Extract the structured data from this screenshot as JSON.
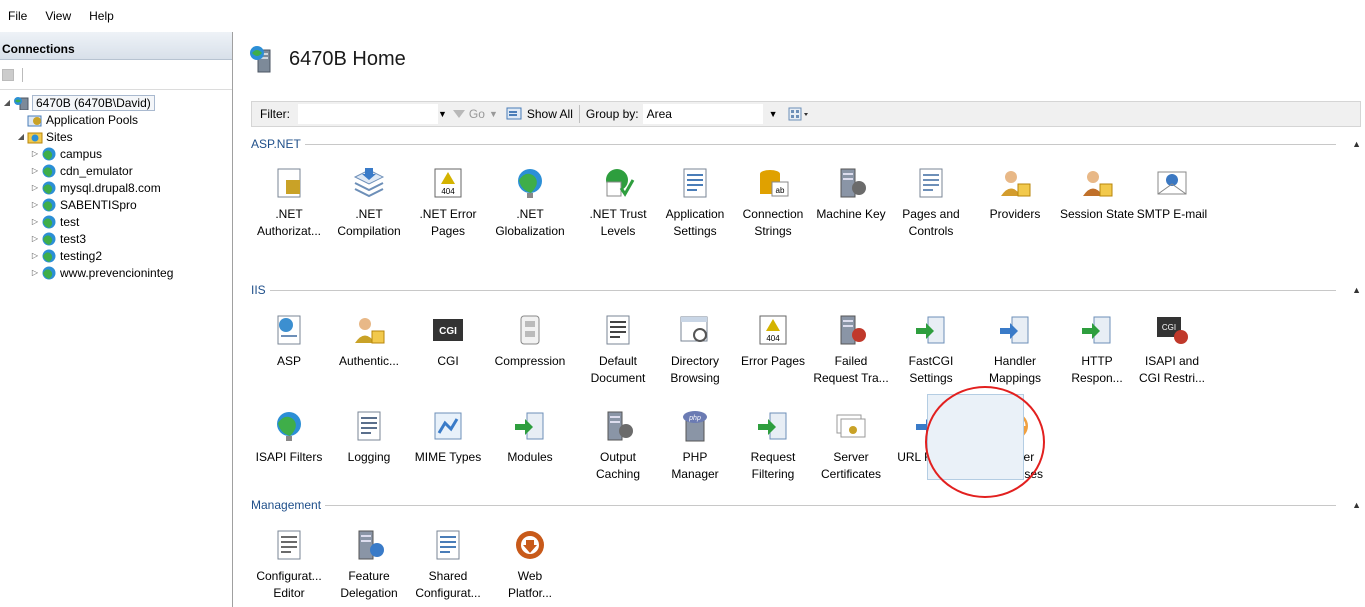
{
  "menu": [
    "File",
    "View",
    "Help"
  ],
  "connections": {
    "header": "Connections",
    "tree": [
      {
        "label": "6470B (6470B\\David)",
        "level": 0,
        "icon": "server-icon"
      },
      {
        "label": "Application Pools",
        "level": 1,
        "icon": "app-pools-icon"
      },
      {
        "label": "Sites",
        "level": 1,
        "icon": "sites-folder-icon"
      },
      {
        "label": "campus",
        "level": 2,
        "icon": "globe-icon"
      },
      {
        "label": "cdn_emulator",
        "level": 2,
        "icon": "globe-icon"
      },
      {
        "label": "mysql.drupal8.com",
        "level": 2,
        "icon": "globe-icon"
      },
      {
        "label": "SABENTISpro",
        "level": 2,
        "icon": "globe-icon"
      },
      {
        "label": "test",
        "level": 2,
        "icon": "globe-icon"
      },
      {
        "label": "test3",
        "level": 2,
        "icon": "globe-icon"
      },
      {
        "label": "testing2",
        "level": 2,
        "icon": "globe-icon"
      },
      {
        "label": "www.prevencioninteg",
        "level": 2,
        "icon": "globe-icon"
      }
    ]
  },
  "home": {
    "title": "6470B Home"
  },
  "filter": {
    "label": "Filter:",
    "go": "Go",
    "show_all": "Show All",
    "group_by_label": "Group by:",
    "group_by_value": "Area"
  },
  "sections": [
    {
      "label": "ASP.NET",
      "features": [
        {
          "label": ".NET\nAuthorizat...",
          "icon": "net-authorization-icon",
          "color": "#c9a227"
        },
        {
          "label": ".NET\nCompilation",
          "icon": "net-compilation-icon",
          "color": "#3a7bc8"
        },
        {
          "label": ".NET Error\nPages",
          "icon": "net-error-pages-icon",
          "color": "#d4b300"
        },
        {
          "label": ".NET\nGlobalization",
          "icon": "net-globalization-icon",
          "color": "#2c8fd6"
        },
        {
          "label": ".NET Trust\nLevels",
          "icon": "net-trust-levels-icon",
          "color": "#2e9e3e"
        },
        {
          "label": "Application\nSettings",
          "icon": "application-settings-icon",
          "color": "#4a7db8"
        },
        {
          "label": "Connection\nStrings",
          "icon": "connection-strings-icon",
          "color": "#e0a100"
        },
        {
          "label": "Machine Key",
          "icon": "machine-key-icon",
          "color": "#6b6b6b"
        },
        {
          "label": "Pages and\nControls",
          "icon": "pages-controls-icon",
          "color": "#6d8fb8"
        },
        {
          "label": "Providers",
          "icon": "providers-icon",
          "color": "#d39c2d"
        },
        {
          "label": "Session State",
          "icon": "session-state-icon",
          "color": "#c0702a"
        },
        {
          "label": "SMTP E-mail",
          "icon": "smtp-email-icon",
          "color": "#3b78c2"
        }
      ]
    },
    {
      "label": "IIS",
      "features": [
        {
          "label": "ASP",
          "icon": "asp-icon",
          "color": "#3c8fd0"
        },
        {
          "label": "Authentic...",
          "icon": "authentication-icon",
          "color": "#c9a227"
        },
        {
          "label": "CGI",
          "icon": "cgi-icon",
          "color": "#333333"
        },
        {
          "label": "Compression",
          "icon": "compression-icon",
          "color": "#8a8a8a"
        },
        {
          "label": "Default\nDocument",
          "icon": "default-document-icon",
          "color": "#444444"
        },
        {
          "label": "Directory\nBrowsing",
          "icon": "directory-browsing-icon",
          "color": "#6d8fb8"
        },
        {
          "label": "Error Pages",
          "icon": "error-pages-icon",
          "color": "#d4b300"
        },
        {
          "label": "Failed\nRequest Tra...",
          "icon": "failed-request-tracing-icon",
          "color": "#c0392b"
        },
        {
          "label": "FastCGI\nSettings",
          "icon": "fastcgi-settings-icon",
          "color": "#2e9e3e"
        },
        {
          "label": "Handler\nMappings",
          "icon": "handler-mappings-icon",
          "color": "#3a7bc8"
        },
        {
          "label": "HTTP\nRespon...",
          "icon": "http-response-icon",
          "color": "#2e9e3e"
        },
        {
          "label": "ISAPI and\nCGI Restri...",
          "icon": "isapi-cgi-restrictions-icon",
          "color": "#444444"
        },
        {
          "label": "ISAPI Filters",
          "icon": "isapi-filters-icon",
          "color": "#2c8fd6"
        },
        {
          "label": "Logging",
          "icon": "logging-icon",
          "color": "#5a6f8c"
        },
        {
          "label": "MIME Types",
          "icon": "mime-types-icon",
          "color": "#3a7bc8"
        },
        {
          "label": "Modules",
          "icon": "modules-icon",
          "color": "#2e9e3e"
        },
        {
          "label": "Output\nCaching",
          "icon": "output-caching-icon",
          "color": "#6b6b6b"
        },
        {
          "label": "PHP\nManager",
          "icon": "php-manager-icon",
          "color": "#6b7bb3"
        },
        {
          "label": "Request\nFiltering",
          "icon": "request-filtering-icon",
          "color": "#2e9e3e"
        },
        {
          "label": "Server\nCertificates",
          "icon": "server-certificates-icon",
          "color": "#c9a227"
        },
        {
          "label": "URL Rewrite",
          "icon": "url-rewrite-icon",
          "color": "#3a7bc8"
        },
        {
          "label": "Worker\nProcesses",
          "icon": "worker-processes-icon",
          "color": "#e07a1f"
        }
      ]
    },
    {
      "label": "Management",
      "features": [
        {
          "label": "Configurat...\nEditor",
          "icon": "configuration-editor-icon",
          "color": "#6b6b6b"
        },
        {
          "label": "Feature\nDelegation",
          "icon": "feature-delegation-icon",
          "color": "#3a7bc8"
        },
        {
          "label": "Shared\nConfigurat...",
          "icon": "shared-configuration-icon",
          "color": "#4a7db8"
        },
        {
          "label": "Web\nPlatfor...",
          "icon": "web-platform-installer-icon",
          "color": "#c85a1a"
        }
      ]
    }
  ]
}
